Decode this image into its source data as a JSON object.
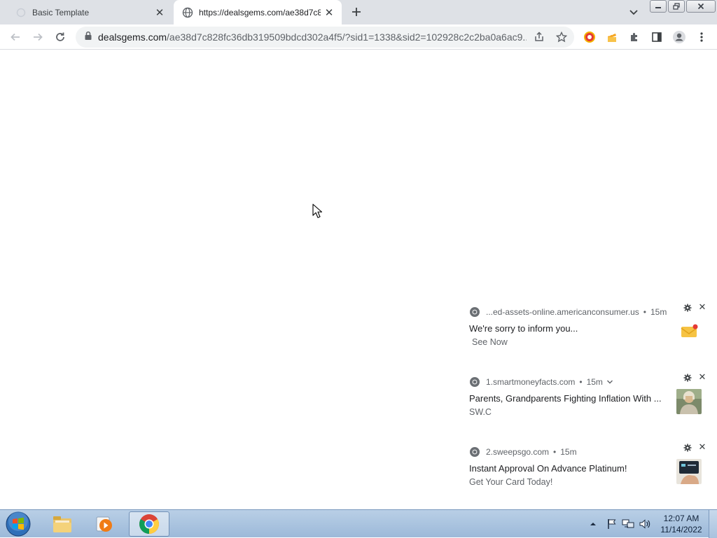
{
  "browser": {
    "tabs": [
      {
        "title": "Basic Template",
        "active": false
      },
      {
        "title": "https://dealsgems.com/ae38d7c8",
        "active": true
      }
    ],
    "url_host": "dealsgems.com",
    "url_path": "/ae38d7c828fc36db319509bdcd302a4f5/?sid1=1338&sid2=102928c2c2ba0a6ac9..."
  },
  "notifications": [
    {
      "source": "...ed-assets-online.americanconsumer.us",
      "time": "15m",
      "title": "We're sorry to inform you...",
      "body": "See Now",
      "thumb": "envelope-icon"
    },
    {
      "source": "1.smartmoneyfacts.com",
      "time": "15m",
      "title": "Parents, Grandparents Fighting Inflation With ...",
      "body": "SW.C",
      "thumb": "person-photo"
    },
    {
      "source": "2.sweepsgo.com",
      "time": "15m",
      "title": "Instant Approval On Advance Platinum!",
      "body": "Get Your Card Today!",
      "thumb": "credit-card-photo"
    }
  ],
  "taskbar": {
    "time": "12:07 AM",
    "date": "11/14/2022"
  },
  "colors": {
    "tabstrip": "#dee1e6",
    "taskbar": "#9cb9d9",
    "text_primary": "#202124",
    "text_secondary": "#5f6368"
  }
}
